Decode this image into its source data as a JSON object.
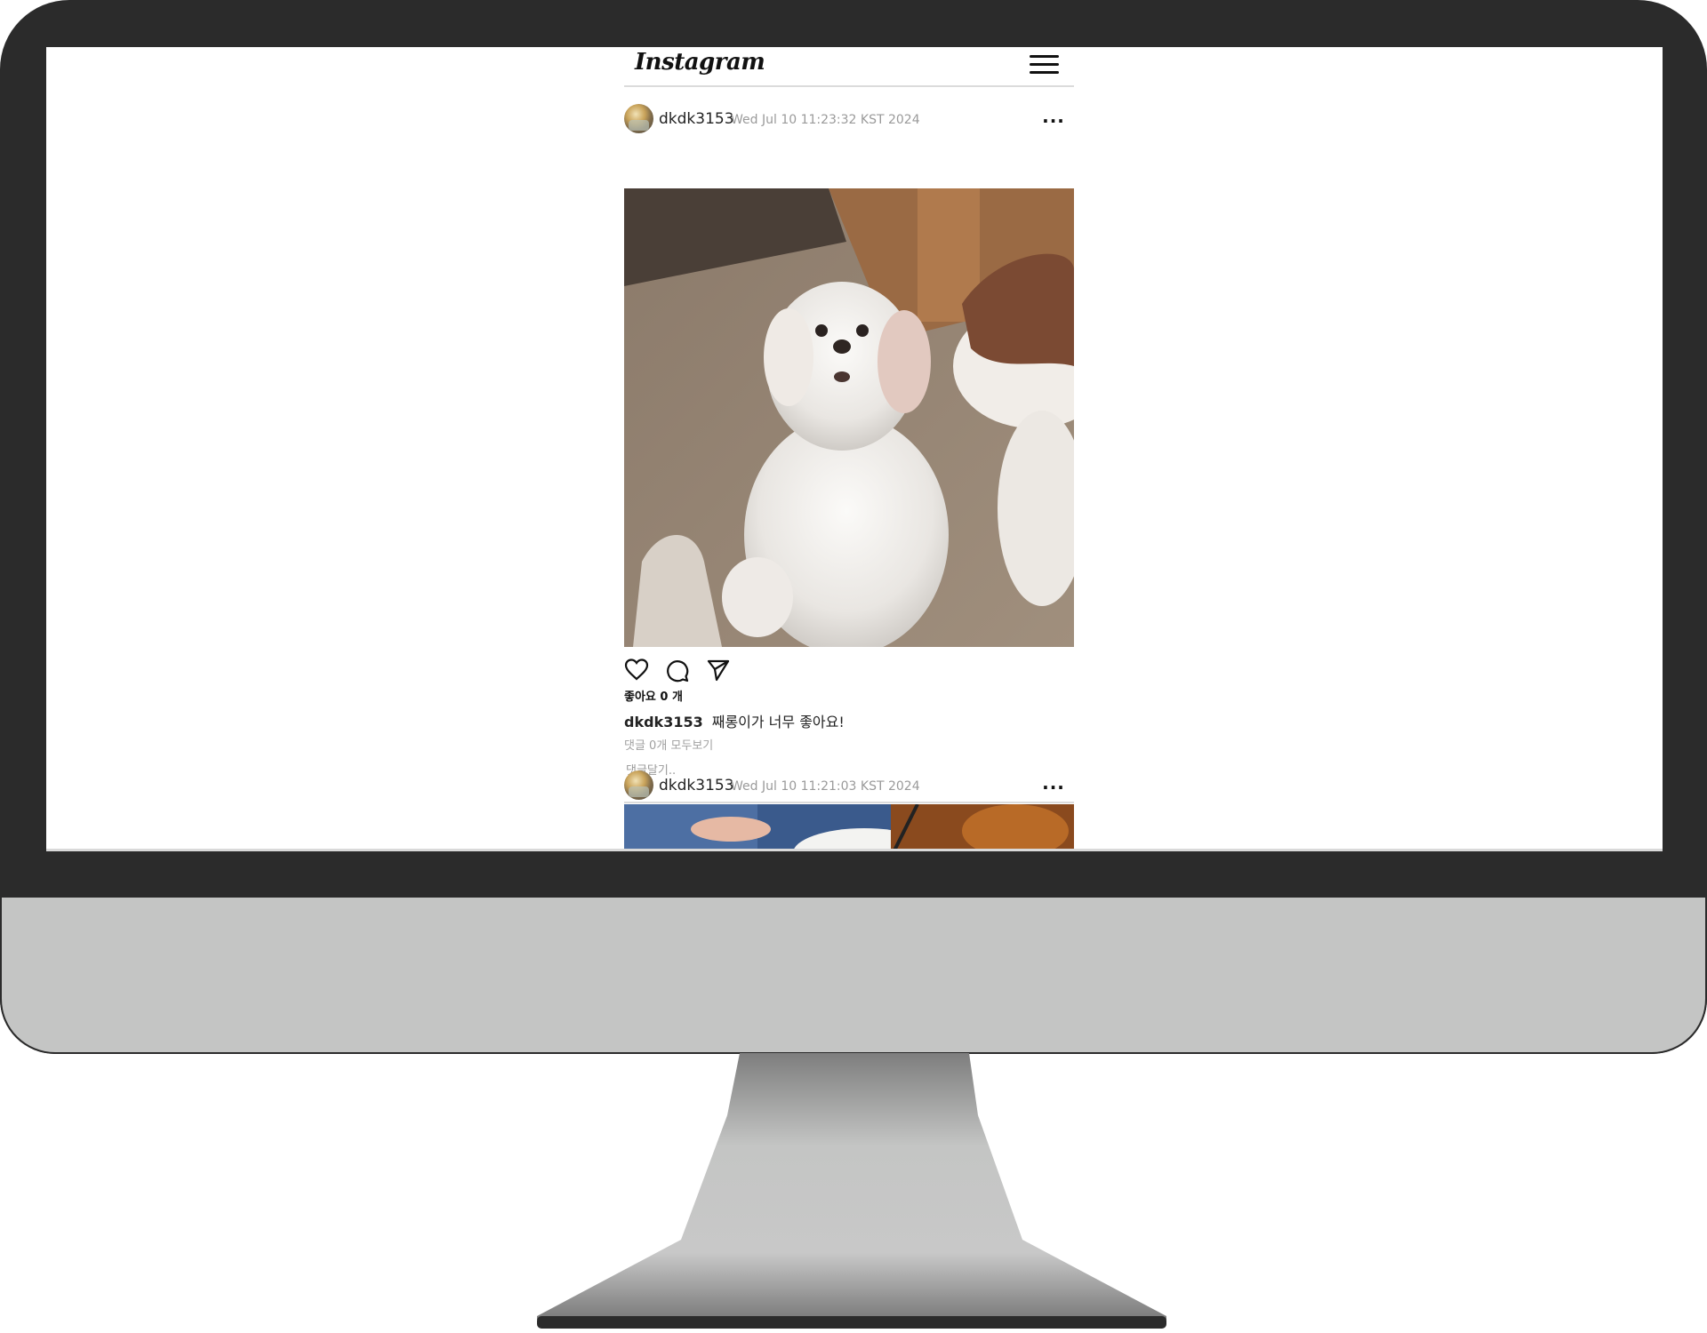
{
  "app": {
    "logo": "Instagram",
    "menu_icon": "hamburger-menu-icon"
  },
  "posts": [
    {
      "username": "dkdk3153",
      "timestamp": "Wed Jul 10 11:23:32 KST 2024",
      "more": "...",
      "likes": "좋아요 0 개",
      "caption_user": "dkdk3153",
      "caption_text": "째롱이가 너무 좋아요!",
      "comments_link": "댓글 0개 모두보기",
      "comment_placeholder": "댓글달기.."
    },
    {
      "username": "dkdk3153",
      "timestamp": "Wed Jul 10 11:21:03 KST 2024",
      "more": "..."
    }
  ],
  "icons": {
    "like": "heart-icon",
    "comment": "comment-bubble-icon",
    "share": "paper-plane-icon",
    "more": "more-dots-icon"
  },
  "colors": {
    "bezel": "#2b2b2b",
    "chin": "#c4c5c4",
    "divider": "#dbdbdb",
    "muted_text": "#9a9a9a"
  }
}
